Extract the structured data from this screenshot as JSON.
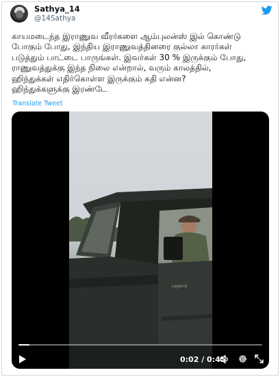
{
  "author": {
    "name": "Sathya_14",
    "handle": "@14Sathya"
  },
  "icons": {
    "brand": "twitter-bird-icon",
    "play": "play-icon",
    "volume": "volume-icon",
    "settings": "gear-icon",
    "fullscreen": "fullscreen-icon"
  },
  "tweet": {
    "text": "காயமடைந்த இராணுவ வீரர்களை ஆம்புலன்ஸ் இல் கொண்டு\nபோகும் போது, இந்திய இராணுவத்தினரை குல்லா காரர்கள்\nபடுத்தும் பாட்டை பாருங்கள். இவர்கள் 30 % இருக்கும் போது,\nராணுவத்துக்கு இந்த நிலை என்றால், வரும் காலத்தில்,\nஹிந்துக்கள் எதிர்கொள்ள இருக்கும் கதி என்ன?\nஹிந்துக்களுக்கு இரண்டே",
    "translate_label": "Translate Tweet"
  },
  "video": {
    "time_display": "0:02 / 0:45",
    "progress_fraction": 0.045
  },
  "colors": {
    "link": "#1d9bf0",
    "brand": "#1d9bf0",
    "handle": "#536471",
    "border": "#cfd9de"
  }
}
